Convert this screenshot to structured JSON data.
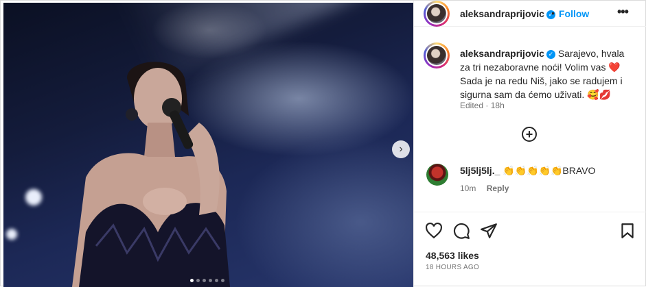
{
  "author": {
    "username": "aleksandraprijovic",
    "verified_icon": "verified-badge-icon",
    "follow_label": "Follow",
    "separator": "•"
  },
  "caption": {
    "username": "aleksandraprijovic",
    "line1": "Sarajevo, hvala za tri nezaboravne noći! Volim vas",
    "line2": "Sada je na redu Niš, jako se radujem i sigurna sam da ćemo uživati.",
    "emoji_heart": "❤️",
    "emoji_end": "🥰💋",
    "edited": "Edited",
    "dot": "·",
    "age": "18h"
  },
  "comment": {
    "username": "5lj5lj5lj._",
    "text": "👏👏👏👏👏BRAVO",
    "age": "10m",
    "reply_label": "Reply"
  },
  "stats": {
    "likes": "48,563 likes",
    "posted": "18 HOURS AGO"
  },
  "carousel": {
    "next_icon": "›",
    "dots": 6,
    "active_dot": 0
  },
  "icons": [
    "heart-icon",
    "comment-icon",
    "share-icon",
    "save-icon",
    "more-icon",
    "add-comment-icon",
    "chevron-right-icon"
  ],
  "colors": {
    "accent": "#0095f6",
    "text": "#262626",
    "muted": "#737373",
    "border": "#efefef"
  }
}
